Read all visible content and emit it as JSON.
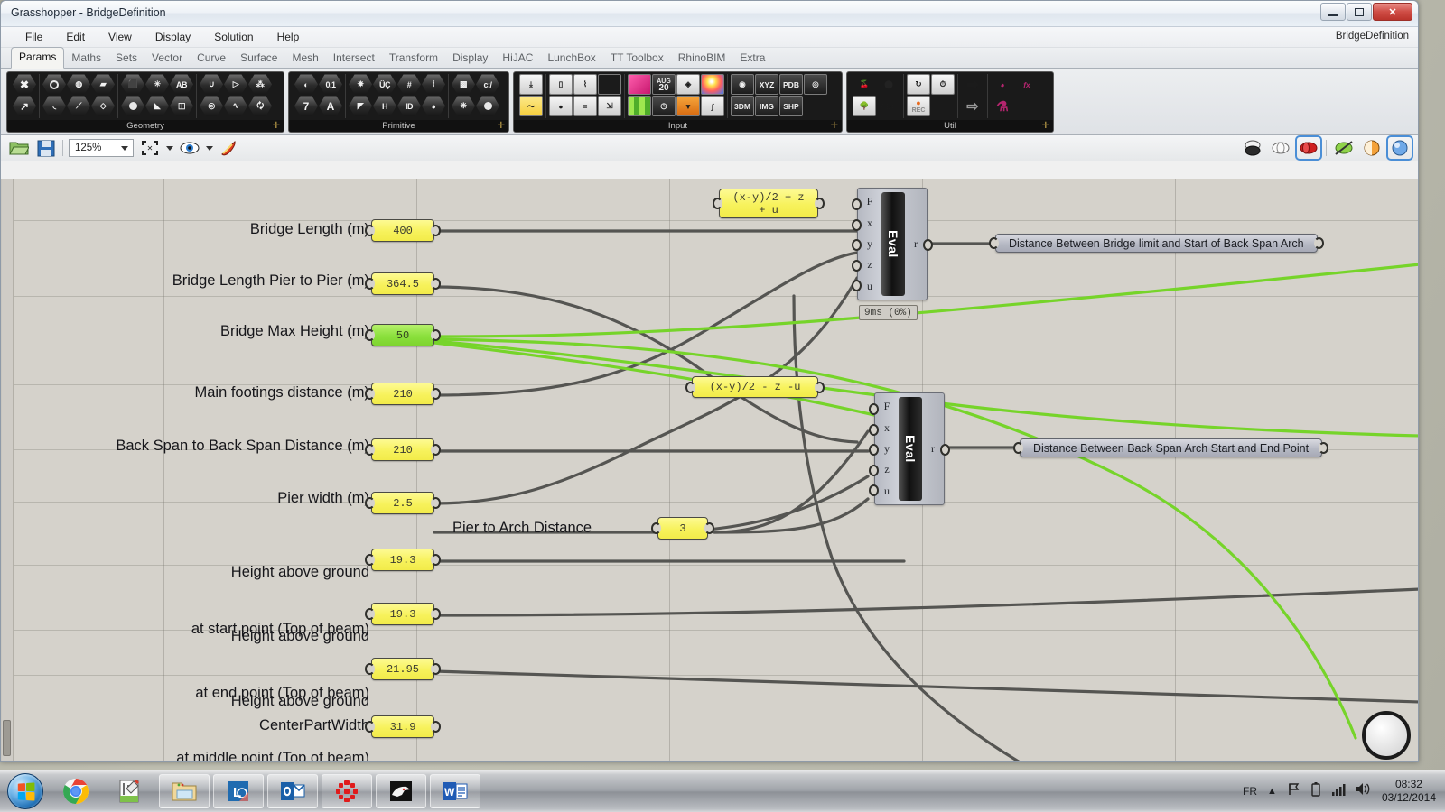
{
  "window": {
    "title": "Grasshopper - BridgeDefinition",
    "document_name": "BridgeDefinition",
    "buttons": {
      "minimize": "minimize-icon",
      "maximize": "maximize-icon",
      "close": "✕"
    }
  },
  "menu": {
    "items": [
      "File",
      "Edit",
      "View",
      "Display",
      "Solution",
      "Help"
    ]
  },
  "tabs": {
    "active": "Params",
    "items": [
      "Params",
      "Maths",
      "Sets",
      "Vector",
      "Curve",
      "Surface",
      "Mesh",
      "Intersect",
      "Transform",
      "Display",
      "HiJAC",
      "LunchBox",
      "TT Toolbox",
      "RhinoBIM",
      "Extra"
    ]
  },
  "ribbon": {
    "panels": [
      {
        "label": "Geometry",
        "groups": [
          {
            "rows": [
              [
                "✖"
              ],
              [
                "↗"
              ]
            ]
          },
          {
            "rows": [
              [
                "circle-o",
                "ellipse",
                "surface"
              ],
              [
                "arc",
                "line-pt",
                "box-pt"
              ]
            ]
          },
          {
            "rows": [
              [
                "box",
                "asterisk",
                "ABC"
              ],
              [
                "sphere",
                "mesh-face",
                "book"
              ]
            ]
          },
          {
            "rows": [
              [
                "magnet",
                "flow",
                "scatter"
              ],
              [
                "spiral",
                "wave",
                "swirl"
              ]
            ]
          }
        ]
      },
      {
        "label": "Primitive",
        "groups": [
          {
            "rows": [
              [
                "ellipse-fill",
                "0.1"
              ],
              [
                "7",
                "A"
              ]
            ]
          },
          {
            "rows": [
              [
                "star-burst",
                "UC",
                "grid",
                "domain"
              ],
              [
                "gradient",
                "H",
                "ID",
                "clock"
              ]
            ]
          },
          {
            "rows": [
              [
                "checker",
                "c:/"
              ],
              [
                "shatter",
                "sphere-shade"
              ]
            ]
          }
        ]
      },
      {
        "label": "Input",
        "groups": [
          {
            "rows": [
              [
                "file-import"
              ],
              [
                "slider-yellow"
              ]
            ]
          },
          {
            "rows": [
              [
                "button",
                "toggle",
                "panel-black"
              ],
              [
                "knob",
                "list",
                "md-slider"
              ]
            ]
          },
          {
            "rows": [
              [
                "gradient-pink",
                "AUG 20",
                "color-wheel-pt",
                "color-sphere"
              ],
              [
                "green-grid",
                "clock-black",
                "paint",
                "graph-curve"
              ]
            ]
          },
          {
            "rows": [
              [
                "atom",
                "XYZ",
                "PDB",
                "search"
              ],
              [
                "3DM",
                "IMG",
                "SHP"
              ]
            ]
          }
        ]
      },
      {
        "label": "Util",
        "groups": [
          {
            "rows": [
              [
                "cherries",
                "blob"
              ],
              [
                "tree",
                "ABC-script"
              ]
            ]
          },
          {
            "rows": [
              [
                "loop",
                "timer"
              ],
              [
                "rec"
              ]
            ]
          },
          {
            "rows": [
              [
                "arrow-filled"
              ],
              [
                "arrow-outline"
              ]
            ]
          },
          {
            "rows": [
              [
                "cluster",
                "fx"
              ],
              [
                "flask"
              ]
            ]
          }
        ]
      }
    ]
  },
  "toolbar": {
    "open_label": "open-file-icon",
    "save_label": "save-icon",
    "zoom_value": "125%",
    "zoom_extents": "zoom-extents-icon",
    "preview": "eye-icon",
    "paint": "paintbrush-icon",
    "right_icons": [
      "shaded-preview-off-icon",
      "wireframe-preview-icon",
      "shaded-preview-icon",
      "preview-off-icon",
      "preview-shaded-icon",
      "preview-render-icon"
    ],
    "right_selected_index": 2
  },
  "canvas": {
    "parameters": [
      {
        "label": "Bridge Length (m)",
        "value": "400",
        "color": "yellow",
        "label_lines": [
          "Bridge Length (m)"
        ]
      },
      {
        "label": "Bridge Length Pier to Pier (m)",
        "value": "364.5",
        "color": "yellow",
        "label_lines": [
          "Bridge Length Pier to Pier (m)"
        ]
      },
      {
        "label": "Bridge Max Height (m)",
        "value": "50",
        "color": "green",
        "label_lines": [
          "Bridge Max Height (m)"
        ]
      },
      {
        "label": "Main footings distance (m)",
        "value": "210",
        "color": "yellow",
        "label_lines": [
          "Main footings distance (m)"
        ]
      },
      {
        "label": "Back Span to Back Span Distance (m)",
        "value": "210",
        "color": "yellow",
        "label_lines": [
          "Back Span to Back Span Distance (m)"
        ]
      },
      {
        "label": "Pier width (m)",
        "value": "2.5",
        "color": "yellow",
        "label_lines": [
          "Pier width (m)"
        ]
      },
      {
        "label": "Height above ground at start point (Top of beam)",
        "value": "19.3",
        "color": "yellow",
        "label_lines": [
          "Height above ground",
          "at start point (Top of beam)"
        ]
      },
      {
        "label": "Height above ground at end point (Top of beam)",
        "value": "19.3",
        "color": "yellow",
        "label_lines": [
          "Height above ground",
          "at end point (Top of beam)"
        ]
      },
      {
        "label": "Height above ground at middle point (Top of beam)",
        "value": "21.95",
        "color": "yellow",
        "label_lines": [
          "Height above ground",
          "at middle point (Top of beam)"
        ]
      },
      {
        "label": "CenterPartWidth",
        "value": "31.9",
        "color": "yellow",
        "label_lines": [
          "CenterPartWidth"
        ]
      },
      {
        "label": "Pier to Arch Distance",
        "value": "3",
        "color": "yellow",
        "label_lines": [
          "Pier to Arch Distance"
        ]
      }
    ],
    "expressions": [
      {
        "lines": [
          "(x-y)/2 + z",
          "+ u"
        ]
      },
      {
        "lines": [
          "(x-y)/2 - z -u"
        ]
      }
    ],
    "eval_components": [
      {
        "name": "Eval",
        "inputs": [
          "F",
          "x",
          "y",
          "z",
          "u"
        ],
        "output": "r",
        "timer": "9ms  (0%)"
      },
      {
        "name": "Eval",
        "inputs": [
          "F",
          "x",
          "y",
          "z",
          "u"
        ],
        "output": "r",
        "timer": ""
      }
    ],
    "panels": [
      {
        "text": "Distance Between Bridge limit and Start of Back Span Arch"
      },
      {
        "text": "Distance Between Back Span Arch Start and End Point"
      }
    ],
    "colors": {
      "background": "#d5d2cb",
      "wire_normal": "#555552",
      "wire_selected": "#76d42a",
      "slider_yellow": "#f7f25c",
      "slider_green": "#8ae03c",
      "panel_gray": "#b6b9c4"
    }
  },
  "taskbar": {
    "start_label": "windows-start-orb",
    "apps": [
      "chrome-icon",
      "notepadpp-icon",
      "file-explorer-icon",
      "lync-icon",
      "outlook-icon",
      "grasshopper-icon",
      "rhino-icon",
      "word-icon"
    ],
    "tray": {
      "language": "FR",
      "icons": [
        "show-hidden-icons",
        "network-flag-icon",
        "battery-icon",
        "signal-icon",
        "volume-icon"
      ],
      "time": "08:32",
      "date": "03/12/2014"
    }
  }
}
